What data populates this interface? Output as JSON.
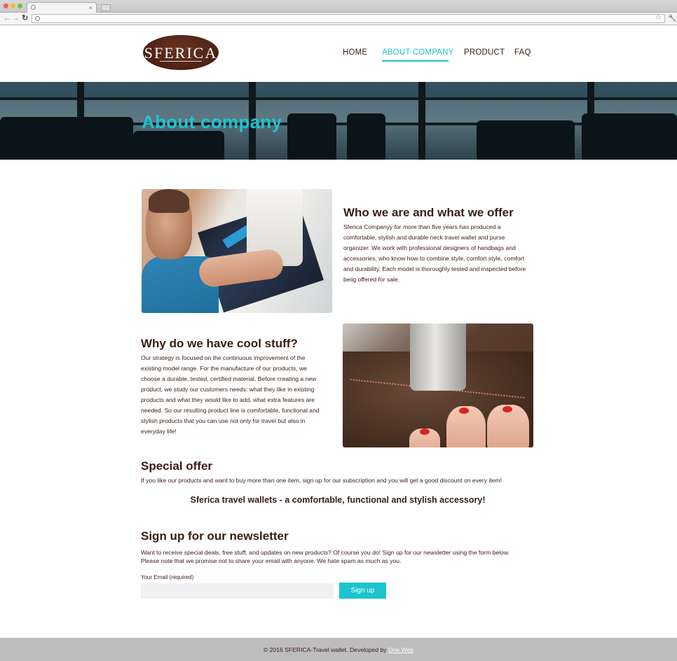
{
  "browser": {
    "tab_title": "",
    "url": ""
  },
  "header": {
    "logo_text": "SFERICA",
    "nav": [
      {
        "label": "HOME",
        "active": false
      },
      {
        "label": "ABOUT COMPANY",
        "active": true
      },
      {
        "label": "PRODUCT",
        "active": false
      },
      {
        "label": "FAQ",
        "active": false
      }
    ]
  },
  "hero": {
    "title": "About company"
  },
  "who": {
    "heading": "Who we are and what we offer",
    "text": "Sferica Companyy for more than five years has produced a comfortable, stylish and durable neck travel wallet and purse organizer. We work with professional designers of handbags and accessories, who know how to combine style, comfort style, comfort and durability. Each model is thoroughly tested and inspected before beiig offered for sale."
  },
  "why": {
    "heading": "Why do we have cool stuff?",
    "text": "Our strategy is focused on the continuous improvement of the existing model range. For the manufacture of our products, we choose a durable, tested, certified material. Before creating a new product, we study our customers needs: what they like in existing products and what they would like to add, what extra features are needed. So our resulting product line is comfortable, functional and stylish products that you can use not only for travel but also in everyday life!"
  },
  "special": {
    "heading": "Special offer",
    "text": "If you like our products and want to buy more than one item, sign up for our subscription and you will get a good discount on every item!",
    "tagline": "Sferica travel wallets - a comfortable, functional and stylish accessory!"
  },
  "newsletter": {
    "heading": "Sign up for our newsletter",
    "text": "Want to receive special deals, free stuff, and updates on new products? Of course you do! Sign up for our newsletter using the form below. Please note that we promise not to share your email with anyone. We hate spam as much as you.",
    "email_label": "Your Email (required)",
    "email_value": "",
    "button_label": "Sign up"
  },
  "footer": {
    "text": "© 2016 SFERICA-Travel wallet. Developed by",
    "link": "One Web"
  },
  "colors": {
    "accent": "#1cc4cf",
    "text": "#3a1c14",
    "logo": "#4a1f12",
    "footer_bg": "#bdbdbd"
  }
}
